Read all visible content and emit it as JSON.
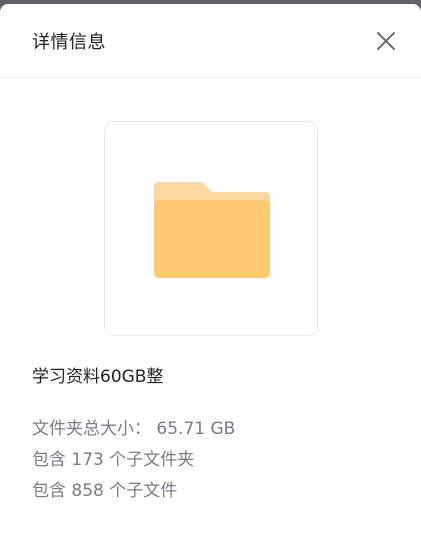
{
  "header": {
    "title": "详情信息",
    "close_icon": "close-icon"
  },
  "preview": {
    "icon": "folder-icon",
    "colors": {
      "folder_back": "#ffd8a0",
      "folder_front": "#ffc872"
    }
  },
  "folder": {
    "name": "学习资料60GB整"
  },
  "details": {
    "total_size_label": "文件夹总大小：",
    "total_size_value": "65.71 GB",
    "subfolders_prefix": "包含",
    "subfolders_count": "173",
    "subfolders_suffix": "个子文件夹",
    "files_prefix": "包含",
    "files_count": "858",
    "files_suffix": "个子文件"
  }
}
